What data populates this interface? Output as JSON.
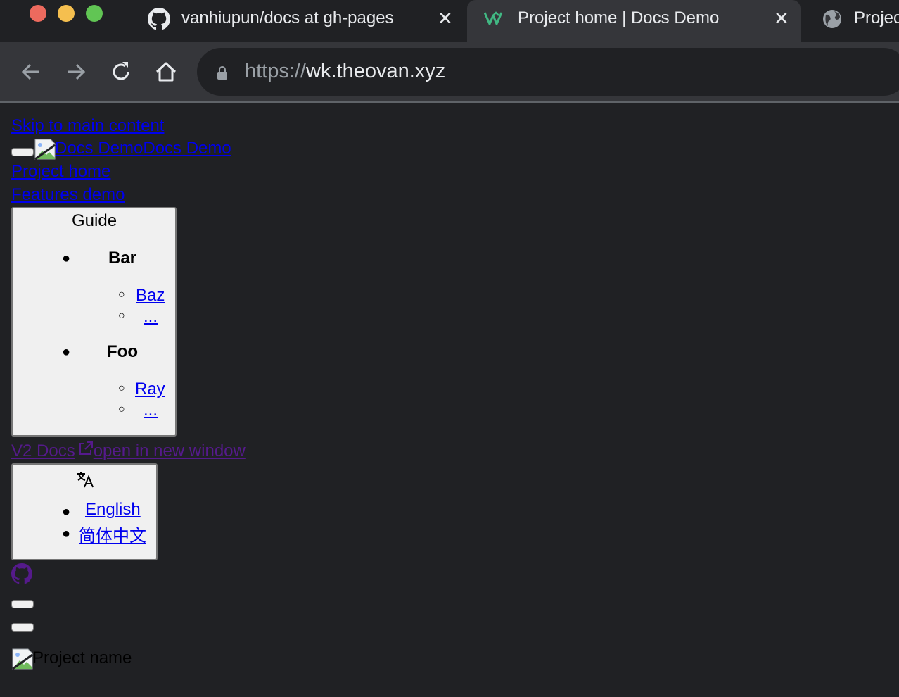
{
  "browser": {
    "tabs": [
      {
        "title": "vanhiupun/docs at gh-pages",
        "icon": "github-icon",
        "active": false
      },
      {
        "title": "Project home | Docs Demo",
        "icon": "vuepress-icon",
        "active": true
      },
      {
        "title": "Projec",
        "icon": "globe-icon",
        "active": false
      }
    ],
    "close_glyph": "✕",
    "url_scheme": "https://",
    "url_host": "wk.theovan.xyz"
  },
  "page": {
    "skip_link": "Skip to main content",
    "brand_alt": "Docs Demo",
    "brand_text": "Docs Demo",
    "nav": [
      "Project home",
      "Features demo"
    ],
    "guide": {
      "label": "Guide",
      "groups": [
        {
          "title": "Bar",
          "items": [
            "Baz",
            "..."
          ]
        },
        {
          "title": "Foo",
          "items": [
            "Ray",
            "..."
          ]
        }
      ]
    },
    "v2_docs": "V2 Docs",
    "new_window": "open in new window",
    "lang_menu": {
      "icon": "translate-icon",
      "items": [
        "English",
        "简体中文"
      ]
    },
    "github_icon": "github-icon",
    "project_name": "Project name"
  },
  "colors": {
    "link": "#0000ee",
    "visited": "#551a8b",
    "tab_active": "#35363a",
    "bg": "#202124"
  }
}
